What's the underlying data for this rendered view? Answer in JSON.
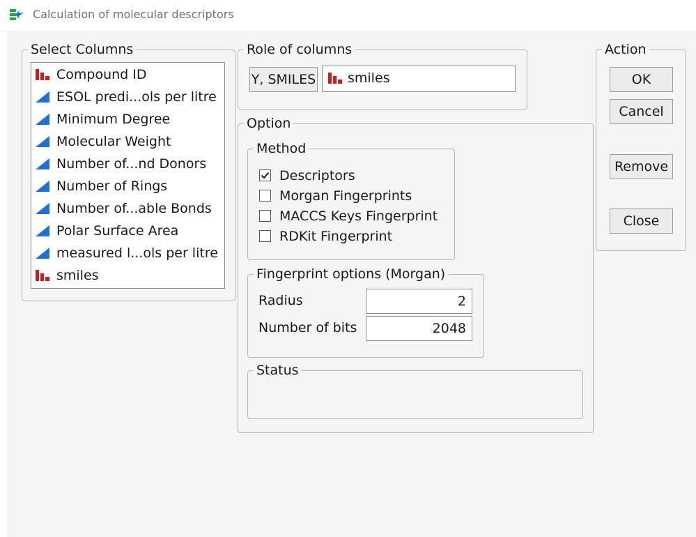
{
  "window": {
    "title": "Calculation of molecular descriptors",
    "icon": "jmp-script-icon"
  },
  "colors": {
    "nominal_icon": "#d01c1c",
    "continuous_icon": "#1f6fd6",
    "app_icon_green": "#27a843",
    "app_icon_blue": "#1e6fd9"
  },
  "select_columns": {
    "title": "Select Columns",
    "items": [
      {
        "label": "Compound ID",
        "icon": "nominal-bar-icon"
      },
      {
        "label": "ESOL predi...ols per litre",
        "icon": "continuous-triangle-icon"
      },
      {
        "label": "Minimum Degree",
        "icon": "continuous-triangle-icon"
      },
      {
        "label": "Molecular Weight",
        "icon": "continuous-triangle-icon"
      },
      {
        "label": "Number of...nd Donors",
        "icon": "continuous-triangle-icon"
      },
      {
        "label": "Number of Rings",
        "icon": "continuous-triangle-icon"
      },
      {
        "label": "Number of...able Bonds",
        "icon": "continuous-triangle-icon"
      },
      {
        "label": "Polar Surface Area",
        "icon": "continuous-triangle-icon"
      },
      {
        "label": "measured l...ols per litre",
        "icon": "continuous-triangle-icon"
      },
      {
        "label": "smiles",
        "icon": "nominal-bar-icon"
      }
    ]
  },
  "role_of_columns": {
    "title": "Role of columns",
    "role_button_label": "Y, SMILES",
    "assigned_column": "smiles"
  },
  "option": {
    "title": "Option",
    "method": {
      "title": "Method",
      "options": [
        {
          "label": "Descriptors",
          "checked": true
        },
        {
          "label": "Morgan Fingerprints",
          "checked": false
        },
        {
          "label": "MACCS Keys Fingerprint",
          "checked": false
        },
        {
          "label": "RDKit Fingerprint",
          "checked": false
        }
      ]
    },
    "fingerprint_options": {
      "title": "Fingerprint options (Morgan)",
      "radius_label": "Radius",
      "radius_value": "2",
      "bits_label": "Number of bits",
      "bits_value": "2048"
    },
    "status": {
      "title": "Status",
      "text": ""
    }
  },
  "action": {
    "title": "Action",
    "ok_label": "OK",
    "cancel_label": "Cancel",
    "remove_label": "Remove",
    "close_label": "Close"
  }
}
